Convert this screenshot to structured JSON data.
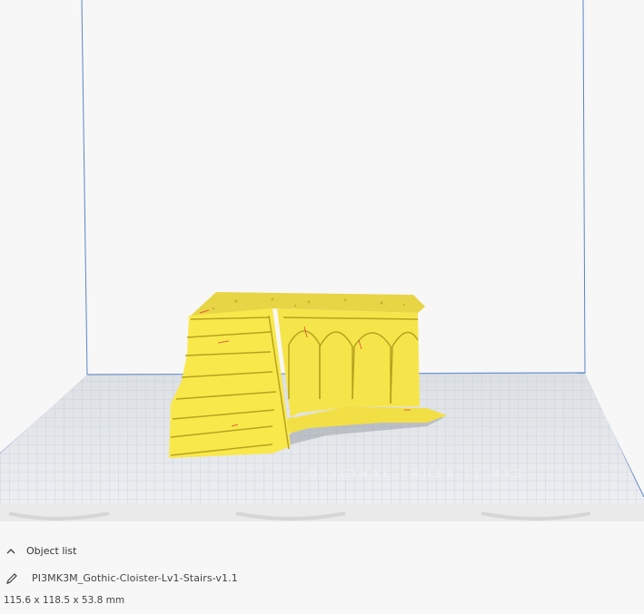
{
  "viewport": {
    "build_plate_watermark": "ORIGINAL PRUSA i3 MK3",
    "model_color": "#f9e84b"
  },
  "object_list": {
    "header_label": "Object list",
    "expand_icon": "chevron-up-icon",
    "edit_icon": "pencil-icon",
    "object_name": "PI3MK3M_Gothic-Cloister-Lv1-Stairs-v1.1",
    "dimensions": "115.6 x 118.5 x 53.8 mm"
  }
}
